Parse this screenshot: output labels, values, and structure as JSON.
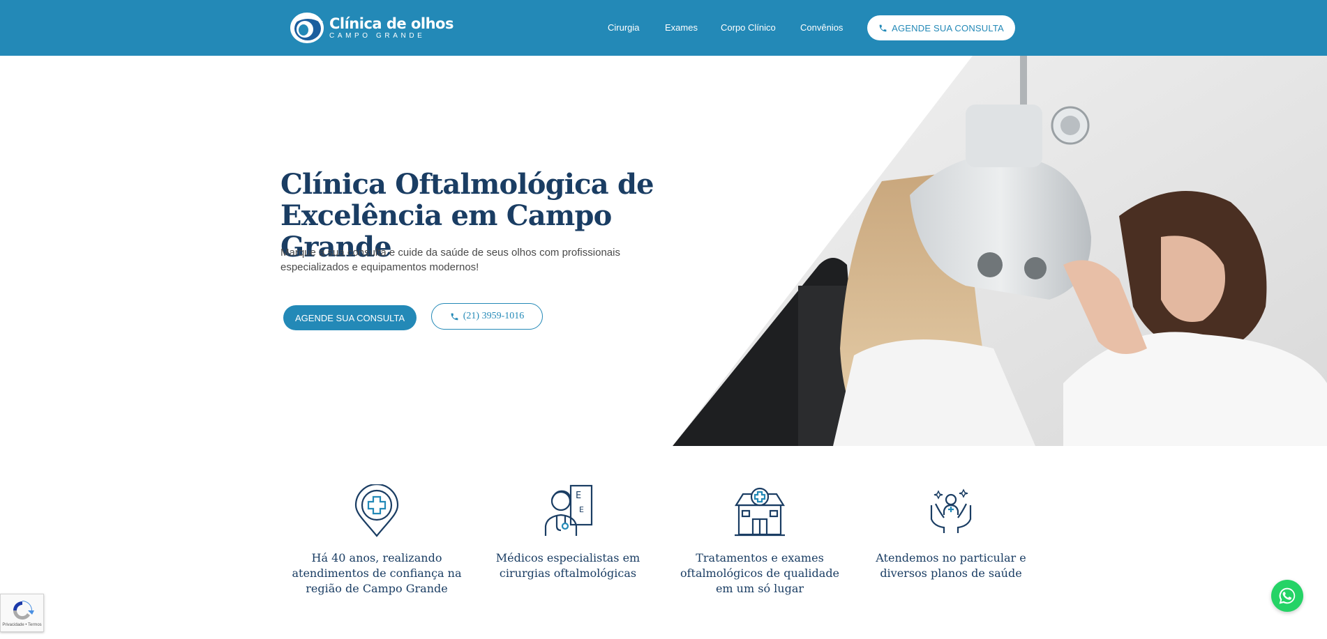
{
  "header": {
    "logo": {
      "name": "Clínica de olhos",
      "sub": "CAMPO GRANDE"
    },
    "nav": [
      {
        "label": "Cirurgia"
      },
      {
        "label": "Exames"
      },
      {
        "label": "Corpo Clínico"
      },
      {
        "label": "Convênios"
      }
    ],
    "cta_label": "AGENDE SUA CONSULTA",
    "cta_icon": "phone-icon"
  },
  "hero": {
    "title": "Clínica Oftalmológica de Excelência em Campo Grande",
    "subtitle": "Marque a sua consulta e cuide da saúde de seus olhos com profissionais especializados e equipamentos modernos!",
    "primary_button": "AGENDE SUA CONSULTA",
    "phone_button": "(21) 3959-1016",
    "photo": "eye-exam-photo"
  },
  "features": [
    {
      "icon": "location-medical-icon",
      "text": "Há 40 anos, realizando atendimentos de confiança na região de Campo Grande"
    },
    {
      "icon": "doctor-eye-chart-icon",
      "text": "Médicos especialistas em cirurgias oftalmológicas"
    },
    {
      "icon": "hospital-building-icon",
      "text": "Tratamentos e exames oftalmológicos de qualidade em um só lugar"
    },
    {
      "icon": "caring-hands-icon",
      "text": "Atendemos no particular e diversos planos de saúde"
    }
  ],
  "floating": {
    "whatsapp_icon": "whatsapp-icon",
    "recaptcha_label": "Privacidade • Termos"
  },
  "colors": {
    "brand": "#2389b7",
    "heading": "#1a3d63",
    "whatsapp": "#25d366"
  }
}
